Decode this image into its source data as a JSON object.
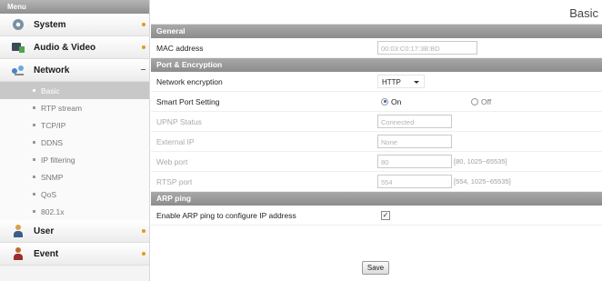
{
  "sidebar": {
    "menu_title": "Menu",
    "items": [
      {
        "label": "System",
        "icon": "system-icon"
      },
      {
        "label": "Audio & Video",
        "icon": "audio-video-icon"
      },
      {
        "label": "Network",
        "icon": "network-icon"
      },
      {
        "label": "User",
        "icon": "user-icon"
      },
      {
        "label": "Event",
        "icon": "event-icon"
      }
    ],
    "network_sub": [
      "Basic",
      "RTP stream",
      "TCP/IP",
      "DDNS",
      "IP filtering",
      "SNMP",
      "QoS",
      "802.1x"
    ],
    "active_sub": "Basic"
  },
  "page": {
    "title": "Basic"
  },
  "general": {
    "section": "General",
    "mac_label": "MAC address",
    "mac_value": "00:03:C0:17:3B:BD"
  },
  "port": {
    "section": "Port & Encryption",
    "encryption_label": "Network encryption",
    "encryption_value": "HTTP",
    "smart_label": "Smart Port Setting",
    "on_label": "On",
    "off_label": "Off",
    "smart_selected": "On",
    "upnp_label": "UPNP Status",
    "upnp_value": "Connected",
    "external_ip_label": "External IP",
    "external_ip_value": "None",
    "web_port_label": "Web port",
    "web_port_value": "80",
    "web_port_hint": "[80, 1025~65535]",
    "rtsp_port_label": "RTSP port",
    "rtsp_port_value": "554",
    "rtsp_port_hint": "[554, 1025~65535]"
  },
  "arp": {
    "section": "ARP ping",
    "enable_label": "Enable ARP ping to configure IP address",
    "enabled": true,
    "check_glyph": "✓"
  },
  "actions": {
    "save_label": "Save"
  }
}
